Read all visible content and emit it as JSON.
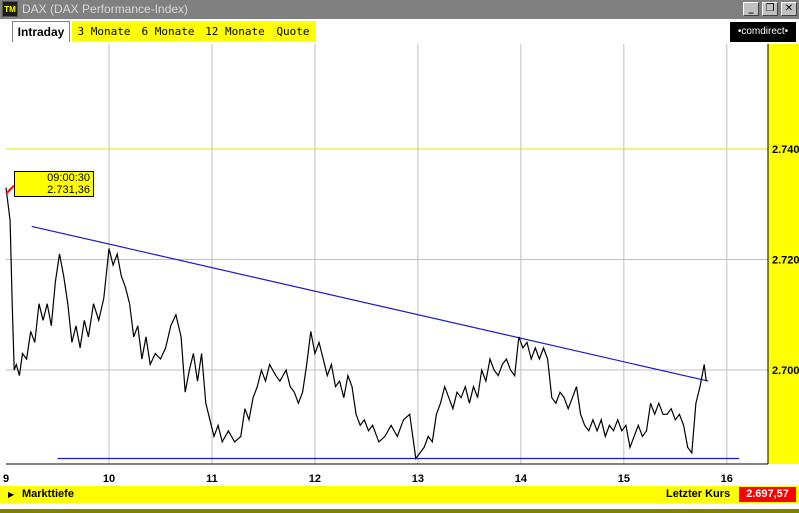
{
  "window": {
    "title": "DAX (DAX Performance-Index)",
    "icon_label": "TM",
    "buttons": {
      "minimize": "_",
      "restore": "❐",
      "close": "✕"
    }
  },
  "tabs": [
    {
      "label": "Intraday",
      "active": true
    },
    {
      "label": "3 Monate",
      "active": false
    },
    {
      "label": "6 Monate",
      "active": false
    },
    {
      "label": "12 Monate",
      "active": false
    },
    {
      "label": "Quote",
      "active": false
    }
  ],
  "brand": {
    "logo_text": "•comdirect•"
  },
  "tooltip": {
    "time": "09:00:30",
    "value": "2.731,36"
  },
  "status": {
    "left_label": "Markttiefe",
    "right_label": "Letzter Kurs",
    "last_price": "2.697,57",
    "arrow_icon": "play-icon"
  },
  "colors": {
    "accent": "#ffff00",
    "price_line": "#000000",
    "trend_line": "#1a1acc",
    "grid": "#c0c0c0",
    "highlight_grid": "#e6e600",
    "last_price_bg": "#ff0000"
  },
  "chart_data": {
    "type": "line",
    "x_tick_labels": [
      "9",
      "10",
      "11",
      "12",
      "13",
      "14",
      "15",
      "16"
    ],
    "y_tick_labels": [
      "2.740",
      "2.720",
      "2.700"
    ],
    "y_ticks": [
      2740,
      2720,
      2700
    ],
    "xlim": [
      9,
      16.4
    ],
    "ylim": [
      2683,
      2759
    ],
    "grid": true,
    "series": [
      {
        "values": [
          [
            9.0,
            2733
          ],
          [
            9.02,
            2730
          ],
          [
            9.04,
            2727
          ],
          [
            9.06,
            2712
          ],
          [
            9.08,
            2700
          ],
          [
            9.1,
            2701
          ],
          [
            9.13,
            2699
          ],
          [
            9.16,
            2703
          ],
          [
            9.2,
            2702
          ],
          [
            9.24,
            2707
          ],
          [
            9.28,
            2705
          ],
          [
            9.32,
            2712
          ],
          [
            9.36,
            2709
          ],
          [
            9.4,
            2712
          ],
          [
            9.44,
            2708
          ],
          [
            9.48,
            2716
          ],
          [
            9.52,
            2721
          ],
          [
            9.56,
            2717
          ],
          [
            9.6,
            2712
          ],
          [
            9.64,
            2705
          ],
          [
            9.68,
            2708
          ],
          [
            9.72,
            2704
          ],
          [
            9.76,
            2709
          ],
          [
            9.8,
            2706
          ],
          [
            9.85,
            2712
          ],
          [
            9.9,
            2709
          ],
          [
            9.95,
            2713
          ],
          [
            10.0,
            2722
          ],
          [
            10.04,
            2719
          ],
          [
            10.08,
            2721
          ],
          [
            10.12,
            2717
          ],
          [
            10.16,
            2715
          ],
          [
            10.2,
            2712
          ],
          [
            10.24,
            2706
          ],
          [
            10.28,
            2708
          ],
          [
            10.32,
            2702
          ],
          [
            10.36,
            2706
          ],
          [
            10.4,
            2701
          ],
          [
            10.45,
            2703
          ],
          [
            10.5,
            2702
          ],
          [
            10.55,
            2704
          ],
          [
            10.6,
            2708
          ],
          [
            10.65,
            2710
          ],
          [
            10.7,
            2706
          ],
          [
            10.74,
            2696
          ],
          [
            10.78,
            2700
          ],
          [
            10.82,
            2703
          ],
          [
            10.86,
            2698
          ],
          [
            10.9,
            2703
          ],
          [
            10.94,
            2694
          ],
          [
            10.98,
            2691
          ],
          [
            11.02,
            2688
          ],
          [
            11.06,
            2690
          ],
          [
            11.1,
            2687
          ],
          [
            11.16,
            2689
          ],
          [
            11.22,
            2687
          ],
          [
            11.28,
            2688
          ],
          [
            11.32,
            2693
          ],
          [
            11.36,
            2691
          ],
          [
            11.4,
            2695
          ],
          [
            11.44,
            2697
          ],
          [
            11.48,
            2700
          ],
          [
            11.52,
            2698
          ],
          [
            11.56,
            2701
          ],
          [
            11.62,
            2699
          ],
          [
            11.66,
            2698
          ],
          [
            11.72,
            2700
          ],
          [
            11.76,
            2697
          ],
          [
            11.8,
            2696
          ],
          [
            11.84,
            2694
          ],
          [
            11.88,
            2696
          ],
          [
            11.92,
            2701
          ],
          [
            11.96,
            2707
          ],
          [
            12.0,
            2703
          ],
          [
            12.04,
            2705
          ],
          [
            12.08,
            2702
          ],
          [
            12.12,
            2699
          ],
          [
            12.16,
            2701
          ],
          [
            12.2,
            2697
          ],
          [
            12.24,
            2698
          ],
          [
            12.28,
            2695
          ],
          [
            12.32,
            2699
          ],
          [
            12.36,
            2697
          ],
          [
            12.4,
            2692
          ],
          [
            12.44,
            2690
          ],
          [
            12.48,
            2691
          ],
          [
            12.52,
            2689
          ],
          [
            12.56,
            2690
          ],
          [
            12.62,
            2687
          ],
          [
            12.68,
            2688
          ],
          [
            12.74,
            2690
          ],
          [
            12.8,
            2688
          ],
          [
            12.86,
            2691
          ],
          [
            12.92,
            2692
          ],
          [
            12.98,
            2684
          ],
          [
            13.02,
            2685
          ],
          [
            13.06,
            2686
          ],
          [
            13.1,
            2688
          ],
          [
            13.14,
            2687
          ],
          [
            13.18,
            2692
          ],
          [
            13.22,
            2694
          ],
          [
            13.26,
            2697
          ],
          [
            13.3,
            2695
          ],
          [
            13.34,
            2693
          ],
          [
            13.38,
            2696
          ],
          [
            13.42,
            2695
          ],
          [
            13.46,
            2697
          ],
          [
            13.5,
            2694
          ],
          [
            13.54,
            2697
          ],
          [
            13.58,
            2695
          ],
          [
            13.62,
            2700
          ],
          [
            13.66,
            2698
          ],
          [
            13.7,
            2702
          ],
          [
            13.74,
            2700
          ],
          [
            13.78,
            2699
          ],
          [
            13.82,
            2701
          ],
          [
            13.86,
            2702
          ],
          [
            13.9,
            2700
          ],
          [
            13.94,
            2699
          ],
          [
            13.98,
            2706
          ],
          [
            14.02,
            2704
          ],
          [
            14.06,
            2705
          ],
          [
            14.1,
            2702
          ],
          [
            14.14,
            2704
          ],
          [
            14.18,
            2702
          ],
          [
            14.22,
            2704
          ],
          [
            14.26,
            2702
          ],
          [
            14.3,
            2695
          ],
          [
            14.34,
            2694
          ],
          [
            14.38,
            2696
          ],
          [
            14.42,
            2695
          ],
          [
            14.46,
            2693
          ],
          [
            14.5,
            2695
          ],
          [
            14.54,
            2697
          ],
          [
            14.58,
            2692
          ],
          [
            14.62,
            2690
          ],
          [
            14.66,
            2689
          ],
          [
            14.7,
            2691
          ],
          [
            14.74,
            2689
          ],
          [
            14.78,
            2691
          ],
          [
            14.82,
            2688
          ],
          [
            14.86,
            2690
          ],
          [
            14.9,
            2689
          ],
          [
            14.94,
            2691
          ],
          [
            14.98,
            2689
          ],
          [
            15.02,
            2690
          ],
          [
            15.06,
            2686
          ],
          [
            15.1,
            2688
          ],
          [
            15.14,
            2690
          ],
          [
            15.18,
            2688
          ],
          [
            15.22,
            2689
          ],
          [
            15.26,
            2694
          ],
          [
            15.3,
            2692
          ],
          [
            15.34,
            2694
          ],
          [
            15.38,
            2692
          ],
          [
            15.42,
            2692
          ],
          [
            15.46,
            2693
          ],
          [
            15.5,
            2691
          ],
          [
            15.54,
            2692
          ],
          [
            15.58,
            2690
          ],
          [
            15.62,
            2686
          ],
          [
            15.66,
            2685
          ],
          [
            15.7,
            2694
          ],
          [
            15.74,
            2697
          ],
          [
            15.78,
            2701
          ],
          [
            15.8,
            2698
          ]
        ]
      },
      {
        "values": [
          [
            9.25,
            2726
          ],
          [
            15.82,
            2698
          ]
        ]
      },
      {
        "values": [
          [
            9.5,
            2684
          ],
          [
            16.12,
            2684
          ]
        ]
      }
    ]
  }
}
